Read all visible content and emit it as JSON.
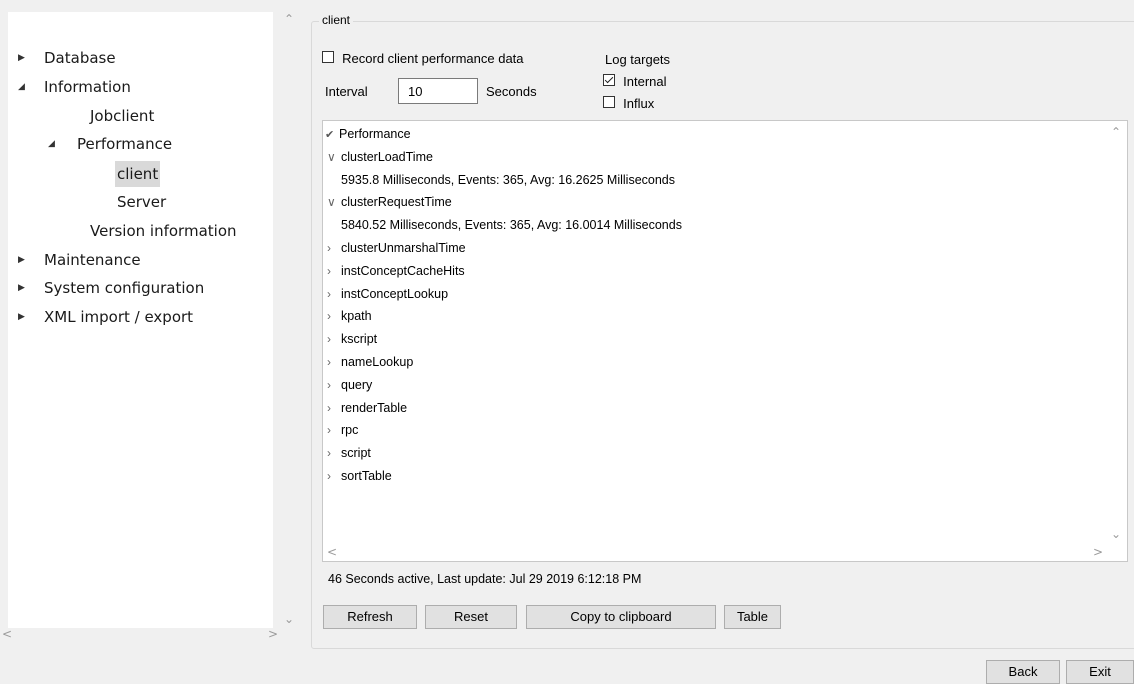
{
  "nav": {
    "items": [
      {
        "label": "Database",
        "expander": "collapsed"
      },
      {
        "label": "Information",
        "expander": "expanded"
      },
      {
        "label": "Jobclient",
        "expander": "none"
      },
      {
        "label": "Performance",
        "expander": "expanded"
      },
      {
        "label": "client",
        "expander": "none",
        "selected": true
      },
      {
        "label": "Server",
        "expander": "none"
      },
      {
        "label": "Version information",
        "expander": "none"
      },
      {
        "label": "Maintenance",
        "expander": "collapsed"
      },
      {
        "label": "System configuration",
        "expander": "collapsed"
      },
      {
        "label": "XML import / export",
        "expander": "collapsed"
      }
    ]
  },
  "client": {
    "group_title": "client",
    "record_label": "Record client performance data",
    "record_checked": false,
    "interval_label": "Interval",
    "interval_value": "10",
    "seconds_label": "Seconds",
    "log_targets_label": "Log targets",
    "targets": [
      {
        "label": "Internal",
        "checked": true
      },
      {
        "label": "Influx",
        "checked": false
      }
    ]
  },
  "tree": {
    "root": "Performance",
    "nodes": [
      {
        "label": "clusterLoadTime",
        "expanded": true,
        "detail": "5935.8 Milliseconds, Events: 365,  Avg: 16.2625 Milliseconds"
      },
      {
        "label": "clusterRequestTime",
        "expanded": true,
        "detail": "5840.52 Milliseconds, Events: 365,  Avg: 16.0014 Milliseconds"
      },
      {
        "label": "clusterUnmarshalTime",
        "expanded": false
      },
      {
        "label": "instConceptCacheHits",
        "expanded": false
      },
      {
        "label": "instConceptLookup",
        "expanded": false
      },
      {
        "label": "kpath",
        "expanded": false
      },
      {
        "label": "kscript",
        "expanded": false
      },
      {
        "label": "nameLookup",
        "expanded": false
      },
      {
        "label": "query",
        "expanded": false
      },
      {
        "label": "renderTable",
        "expanded": false
      },
      {
        "label": "rpc",
        "expanded": false
      },
      {
        "label": "script",
        "expanded": false
      },
      {
        "label": "sortTable",
        "expanded": false
      }
    ]
  },
  "status": "46 Seconds active, Last update: Jul 29 2019 6:12:18 PM",
  "buttons": {
    "refresh": "Refresh",
    "reset": "Reset",
    "copy": "Copy to clipboard",
    "table": "Table",
    "back": "Back",
    "exit": "Exit"
  },
  "colors": {
    "selection": "#d9d9d9",
    "window_bg": "#f0f0f0"
  }
}
